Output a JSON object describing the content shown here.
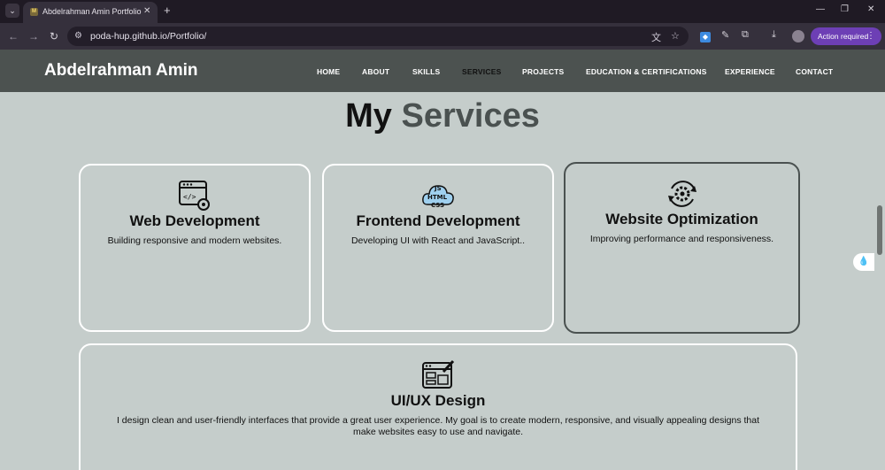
{
  "browser": {
    "tab_title": "Abdelrahman Amin Portfolio",
    "url": "poda-hup.github.io/Portfolio/",
    "action_required_label": "Action required",
    "icons": [
      "tab-list-icon",
      "close-icon",
      "plus-icon",
      "back-icon",
      "forward-icon",
      "reload-icon",
      "site-info-icon",
      "translate-icon",
      "star-icon",
      "extension-icon",
      "puzzle-icon",
      "download-icon",
      "kebab-menu-icon",
      "minimize-icon",
      "restore-icon",
      "window-close-icon"
    ],
    "accent_color": "#6d3fb5"
  },
  "site": {
    "brand": "Abdelrahman Amin",
    "nav": [
      {
        "label": "HOME"
      },
      {
        "label": "ABOUT"
      },
      {
        "label": "SKILLS"
      },
      {
        "label": "SERVICES"
      },
      {
        "label": "PROJECTS"
      },
      {
        "label": "EDUCATION & CERTIFICATIONS"
      },
      {
        "label": "EXPERIENCE"
      },
      {
        "label": "CONTACT"
      }
    ],
    "active_nav": "SERVICES",
    "nav_bg": "#4c5250",
    "page_bg": "#c5cdcb"
  },
  "services": {
    "title_part1": "My",
    "title_part2": "Services",
    "cards": [
      {
        "title": "Web Development",
        "description": "Building responsive and modern websites.",
        "icon": "web-settings-icon"
      },
      {
        "title": "Frontend Development",
        "description": "Developing UI with React and JavaScript..",
        "icon": "html-css-js-cloud-icon"
      },
      {
        "title": "Website Optimization",
        "description": "Improving performance and responsiveness.",
        "icon": "gear-refresh-icon"
      },
      {
        "title": "UI/UX Design",
        "description": "I design clean and user-friendly interfaces that provide a great user experience. My goal is to create modern, responsive, and visually appealing designs that make websites easy to use and navigate.",
        "icon": "design-layout-brush-icon"
      }
    ]
  }
}
